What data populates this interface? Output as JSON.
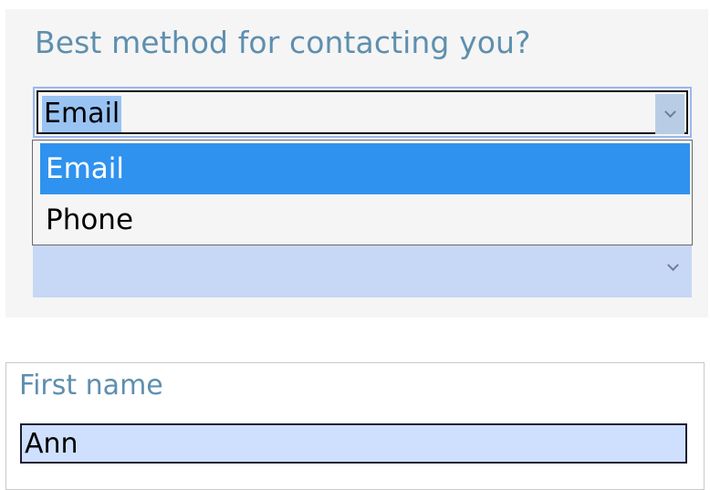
{
  "contact_section": {
    "question": "Best method for contacting you?",
    "select": {
      "value": "Email",
      "options": [
        {
          "label": "Email",
          "selected": true
        },
        {
          "label": "Phone",
          "selected": false
        }
      ]
    }
  },
  "name_section": {
    "label": "First name",
    "input_value": "Ann"
  },
  "colors": {
    "label_text": "#5e8fae",
    "option_highlight": "#2f92ef",
    "input_background": "#cfe0ff",
    "panel_background": "#f5f5f5"
  }
}
